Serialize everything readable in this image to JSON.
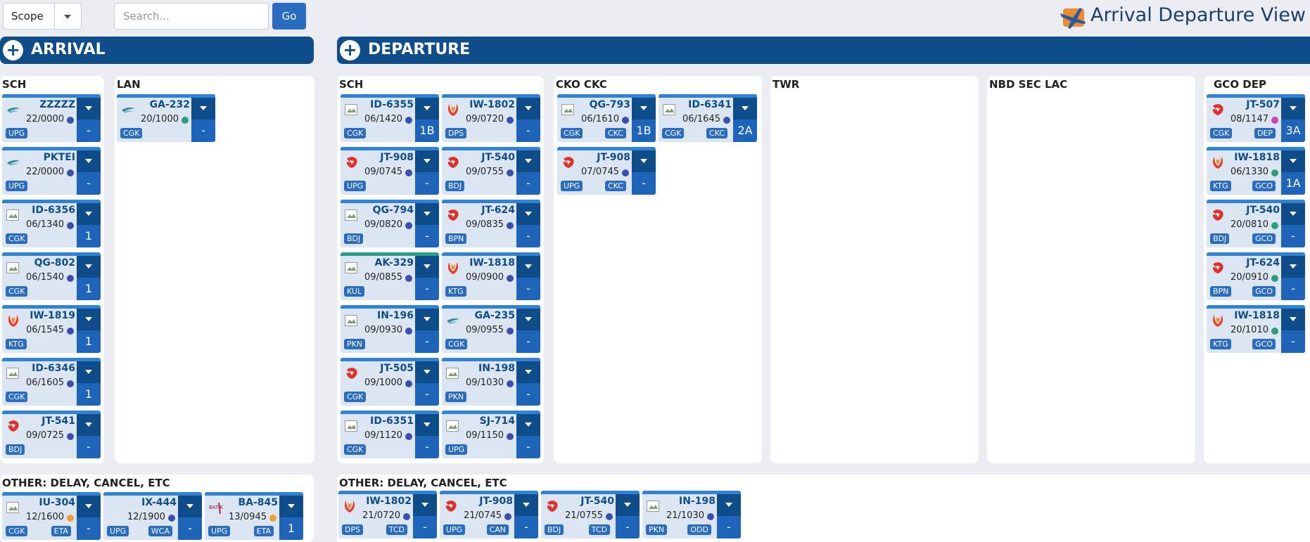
{
  "header": {
    "scope_label": "Scope",
    "search_placeholder": "Search...",
    "go_label": "Go",
    "app_title": "Arrival Departure View"
  },
  "colors": {
    "primary": "#0f4c8a",
    "accent": "#2a6cc0",
    "dot_blue": "#3a4fb0",
    "dot_green": "#2a9d7a",
    "dot_orange": "#f0a030",
    "dot_magenta": "#d040b0"
  },
  "arrival": {
    "title": "ARRIVAL",
    "sch": {
      "title": "SCH",
      "cards": [
        {
          "flight": "ZZZZZ",
          "time": "22/0000",
          "dot": "blue",
          "badge1": "UPG",
          "badge2": "",
          "slot": "-",
          "icon": "garuda-logo"
        },
        {
          "flight": "PKTEI",
          "time": "22/0000",
          "dot": "blue",
          "badge1": "UPG",
          "badge2": "",
          "slot": "-",
          "icon": "garuda-logo"
        },
        {
          "flight": "ID-6356",
          "time": "06/1340",
          "dot": "blue",
          "badge1": "CGK",
          "badge2": "",
          "slot": "1",
          "icon": "broken-image"
        },
        {
          "flight": "QG-802",
          "time": "06/1540",
          "dot": "blue",
          "badge1": "CGK",
          "badge2": "",
          "slot": "1",
          "icon": "broken-image"
        },
        {
          "flight": "IW-1819",
          "time": "06/1545",
          "dot": "blue",
          "badge1": "KTG",
          "badge2": "",
          "slot": "1",
          "icon": "wings-logo"
        },
        {
          "flight": "ID-6346",
          "time": "06/1605",
          "dot": "blue",
          "badge1": "CGK",
          "badge2": "",
          "slot": "1",
          "icon": "broken-image"
        },
        {
          "flight": "JT-541",
          "time": "09/0725",
          "dot": "blue",
          "badge1": "BDJ",
          "badge2": "",
          "slot": "-",
          "icon": "lion-logo"
        }
      ]
    },
    "lan": {
      "title": "LAN",
      "cards": [
        {
          "flight": "GA-232",
          "time": "20/1000",
          "dot": "green",
          "badge1": "CGK",
          "badge2": "",
          "slot": "-",
          "icon": "garuda-logo"
        }
      ]
    },
    "other": {
      "title": "OTHER: DELAY, CANCEL, ETC",
      "cards": [
        {
          "flight": "IU-304",
          "time": "12/1600",
          "dot": "orange",
          "badge1": "CGK",
          "badge2": "ETA",
          "slot": "-",
          "icon": "broken-image"
        },
        {
          "flight": "IX-444",
          "time": "12/1900",
          "dot": "blue",
          "badge1": "UPG",
          "badge2": "WCA",
          "slot": "-",
          "icon": "none"
        },
        {
          "flight": "BA-845",
          "time": "13/0945",
          "dot": "orange",
          "badge1": "UPG",
          "badge2": "ETA",
          "slot": "1",
          "icon": "batik-logo"
        }
      ]
    }
  },
  "departure": {
    "title": "DEPARTURE",
    "sch": {
      "title": "SCH",
      "cards": [
        {
          "flight": "ID-6355",
          "time": "06/1420",
          "dot": "blue",
          "badge1": "CGK",
          "badge2": "",
          "slot": "1B",
          "icon": "broken-image"
        },
        {
          "flight": "IW-1802",
          "time": "09/0720",
          "dot": "blue",
          "badge1": "DPS",
          "badge2": "",
          "slot": "-",
          "icon": "wings-logo"
        },
        {
          "flight": "JT-908",
          "time": "09/0745",
          "dot": "blue",
          "badge1": "UPG",
          "badge2": "",
          "slot": "-",
          "icon": "lion-logo"
        },
        {
          "flight": "JT-540",
          "time": "09/0755",
          "dot": "blue",
          "badge1": "BDJ",
          "badge2": "",
          "slot": "-",
          "icon": "lion-logo"
        },
        {
          "flight": "QG-794",
          "time": "09/0820",
          "dot": "blue",
          "badge1": "BDJ",
          "badge2": "",
          "slot": "-",
          "icon": "broken-image"
        },
        {
          "flight": "JT-624",
          "time": "09/0835",
          "dot": "blue",
          "badge1": "BPN",
          "badge2": "",
          "slot": "-",
          "icon": "lion-logo"
        },
        {
          "flight": "AK-329",
          "time": "09/0855",
          "dot": "blue",
          "badge1": "KUL",
          "badge2": "",
          "slot": "-",
          "icon": "broken-image",
          "teal": true
        },
        {
          "flight": "IW-1818",
          "time": "09/0900",
          "dot": "blue",
          "badge1": "KTG",
          "badge2": "",
          "slot": "-",
          "icon": "wings-logo"
        },
        {
          "flight": "IN-196",
          "time": "09/0930",
          "dot": "blue",
          "badge1": "PKN",
          "badge2": "",
          "slot": "-",
          "icon": "broken-image"
        },
        {
          "flight": "GA-235",
          "time": "09/0955",
          "dot": "blue",
          "badge1": "CGK",
          "badge2": "",
          "slot": "-",
          "icon": "garuda-logo"
        },
        {
          "flight": "JT-505",
          "time": "09/1000",
          "dot": "blue",
          "badge1": "CGK",
          "badge2": "",
          "slot": "-",
          "icon": "lion-logo"
        },
        {
          "flight": "IN-198",
          "time": "09/1030",
          "dot": "blue",
          "badge1": "PKN",
          "badge2": "",
          "slot": "-",
          "icon": "broken-image"
        },
        {
          "flight": "ID-6351",
          "time": "09/1120",
          "dot": "blue",
          "badge1": "CGK",
          "badge2": "",
          "slot": "-",
          "icon": "broken-image"
        },
        {
          "flight": "SJ-714",
          "time": "09/1150",
          "dot": "blue",
          "badge1": "UPG",
          "badge2": "",
          "slot": "-",
          "icon": "broken-image"
        }
      ]
    },
    "cko": {
      "title": "CKO  CKC",
      "cards": [
        {
          "flight": "QG-793",
          "time": "06/1610",
          "dot": "blue",
          "badge1": "CGK",
          "badge2": "CKC",
          "slot": "1B",
          "icon": "broken-image"
        },
        {
          "flight": "ID-6341",
          "time": "06/1645",
          "dot": "blue",
          "badge1": "CGK",
          "badge2": "CKC",
          "slot": "2A",
          "icon": "broken-image"
        },
        {
          "flight": "JT-908",
          "time": "07/0745",
          "dot": "blue",
          "badge1": "UPG",
          "badge2": "CKC",
          "slot": "-",
          "icon": "lion-logo"
        }
      ]
    },
    "twr": {
      "title": "TWR"
    },
    "nbd": {
      "title": "NBD  SEC  LAC"
    },
    "gco": {
      "title": "GCO   DEP",
      "cards": [
        {
          "flight": "JT-507",
          "time": "08/1147",
          "dot": "magenta",
          "badge1": "CGK",
          "badge2": "DEP",
          "slot": "3A",
          "icon": "lion-logo"
        },
        {
          "flight": "IW-1818",
          "time": "06/1330",
          "dot": "green",
          "badge1": "KTG",
          "badge2": "GCO",
          "slot": "1A",
          "icon": "wings-logo"
        },
        {
          "flight": "JT-540",
          "time": "20/0810",
          "dot": "green",
          "badge1": "BDJ",
          "badge2": "GCO",
          "slot": "-",
          "icon": "lion-logo"
        },
        {
          "flight": "JT-624",
          "time": "20/0910",
          "dot": "green",
          "badge1": "BPN",
          "badge2": "GCO",
          "slot": "-",
          "icon": "lion-logo"
        },
        {
          "flight": "IW-1818",
          "time": "20/1010",
          "dot": "green",
          "badge1": "KTG",
          "badge2": "GCO",
          "slot": "-",
          "icon": "wings-logo"
        }
      ]
    },
    "other": {
      "title": "OTHER: DELAY, CANCEL, ETC",
      "cards": [
        {
          "flight": "IW-1802",
          "time": "21/0720",
          "dot": "blue",
          "badge1": "DPS",
          "badge2": "TCD",
          "slot": "-",
          "icon": "wings-logo"
        },
        {
          "flight": "JT-908",
          "time": "21/0745",
          "dot": "blue",
          "badge1": "UPG",
          "badge2": "CAN",
          "slot": "-",
          "icon": "lion-logo"
        },
        {
          "flight": "JT-540",
          "time": "21/0755",
          "dot": "blue",
          "badge1": "BDJ",
          "badge2": "TCD",
          "slot": "-",
          "icon": "lion-logo"
        },
        {
          "flight": "IN-198",
          "time": "21/1030",
          "dot": "blue",
          "badge1": "PKN",
          "badge2": "ODD",
          "slot": "-",
          "icon": "broken-image"
        }
      ]
    }
  }
}
